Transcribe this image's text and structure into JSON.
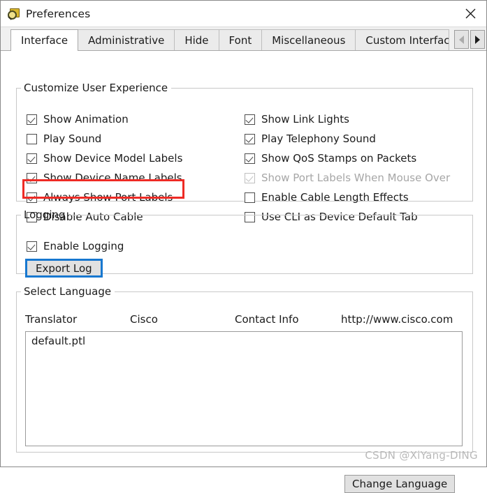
{
  "window": {
    "title": "Preferences",
    "icon": "preferences-magnifier-icon",
    "close_label": "✕"
  },
  "tabs": [
    {
      "label": "Interface",
      "selected": true
    },
    {
      "label": "Administrative",
      "selected": false
    },
    {
      "label": "Hide",
      "selected": false
    },
    {
      "label": "Font",
      "selected": false
    },
    {
      "label": "Miscellaneous",
      "selected": false
    },
    {
      "label": "Custom Interface",
      "selected": false
    }
  ],
  "tab_scroll": {
    "left_label": "◀",
    "right_label": "▶"
  },
  "customize": {
    "legend": "Customize User Experience",
    "left_options": [
      {
        "label": "Show Animation",
        "checked": true,
        "disabled": false
      },
      {
        "label": "Play Sound",
        "checked": false,
        "disabled": false
      },
      {
        "label": "Show Device Model Labels",
        "checked": true,
        "disabled": false
      },
      {
        "label": "Show Device Name Labels",
        "checked": true,
        "disabled": false
      },
      {
        "label": "Always Show Port Labels",
        "checked": true,
        "disabled": false
      },
      {
        "label": "Disable Auto Cable",
        "checked": false,
        "disabled": false
      }
    ],
    "right_options": [
      {
        "label": "Show Link Lights",
        "checked": true,
        "disabled": false
      },
      {
        "label": "Play Telephony Sound",
        "checked": true,
        "disabled": false
      },
      {
        "label": "Show QoS Stamps on Packets",
        "checked": true,
        "disabled": false
      },
      {
        "label": "Show Port Labels When Mouse Over",
        "checked": true,
        "disabled": true
      },
      {
        "label": "Enable Cable Length Effects",
        "checked": false,
        "disabled": false
      },
      {
        "label": "Use CLI as Device Default Tab",
        "checked": false,
        "disabled": false
      }
    ],
    "highlight_target": "Always Show Port Labels",
    "highlight_color": "#ee2b25"
  },
  "logging": {
    "legend": "Logging",
    "enable_logging": {
      "label": "Enable Logging",
      "checked": true
    },
    "export_log_label": "Export Log",
    "focus_color": "#1878d0"
  },
  "language": {
    "legend": "Select Language",
    "headers": [
      "Translator",
      "Cisco",
      "Contact Info",
      "http://www.cisco.com"
    ],
    "items": [
      "default.ptl"
    ],
    "change_language_label": "Change Language"
  },
  "watermark": "CSDN @XiYang-DING"
}
